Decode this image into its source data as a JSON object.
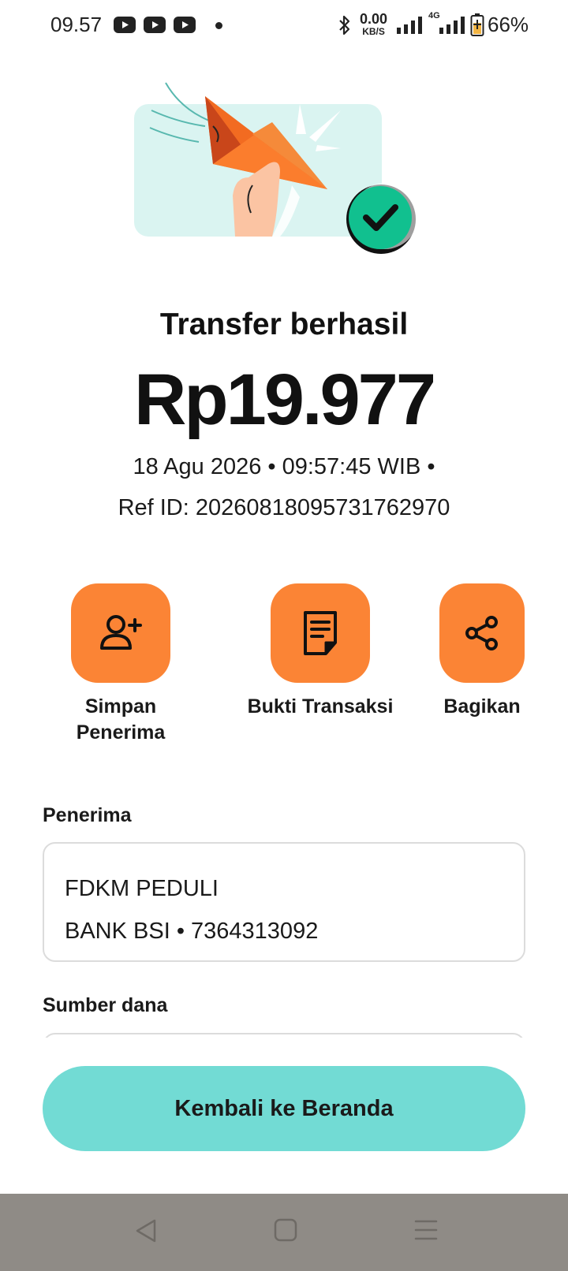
{
  "status_bar": {
    "time": "09.57",
    "notification_icons": [
      "youtube-icon",
      "youtube-icon",
      "youtube-icon"
    ],
    "network_speed_value": "0.00",
    "network_speed_unit": "KB/S",
    "network_type": "4G",
    "battery": "66%"
  },
  "transfer": {
    "title": "Transfer berhasil",
    "amount": "Rp19.977",
    "datetime": "18 Agu 2026 • 09:57:45 WIB •",
    "ref": "Ref ID: 20260818095731762970"
  },
  "actions": [
    {
      "label": "Simpan Penerima",
      "icon": "add-person-icon"
    },
    {
      "label": "Bukti Transaksi",
      "icon": "receipt-icon"
    },
    {
      "label": "Bagikan",
      "icon": "share-icon"
    }
  ],
  "recipient": {
    "section_label": "Penerima",
    "name": "FDKM PEDULI",
    "bank": "BANK BSI • 7364313092"
  },
  "source": {
    "section_label": "Sumber dana"
  },
  "footer": {
    "home_button": "Kembali ke Beranda"
  },
  "nav": {
    "buttons": [
      "back-icon",
      "home-icon",
      "menu-icon"
    ]
  },
  "colors": {
    "accent_orange": "#fb8435",
    "primary_teal": "#72dbd4",
    "success_green": "#11c08f",
    "nav_gray": "#8f8b86"
  }
}
